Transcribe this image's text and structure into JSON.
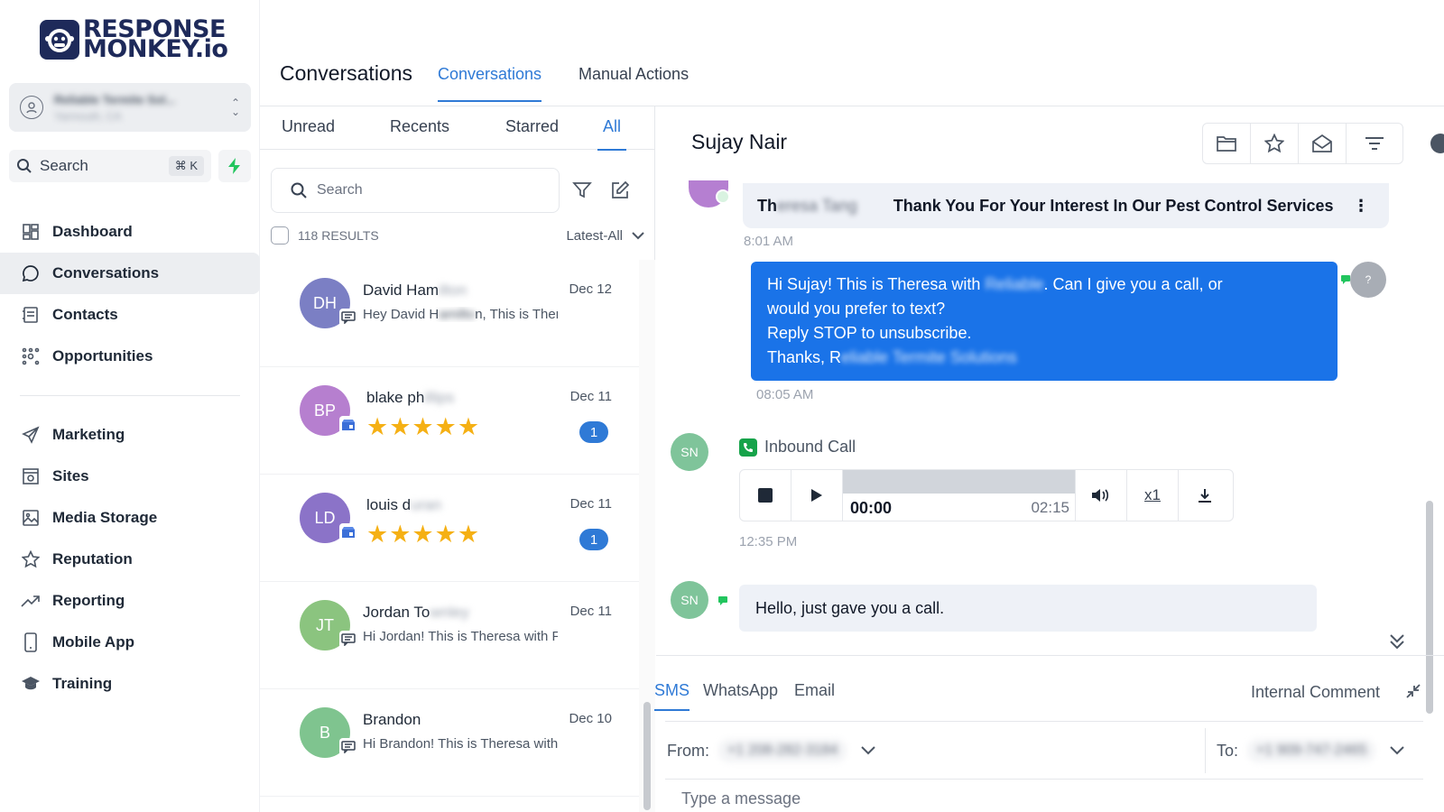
{
  "brand": {
    "line1": "RESPONSE",
    "line2": "MONKEY.io",
    "color": "#1e2a5a"
  },
  "account": {
    "name": "Reliable Termite Sol...",
    "location": "Yarmouth, CA"
  },
  "sidebar": {
    "search_label": "Search",
    "search_shortcut": "⌘ K",
    "items": [
      {
        "label": "Dashboard",
        "icon": "dashboard-icon"
      },
      {
        "label": "Conversations",
        "icon": "chat-icon"
      },
      {
        "label": "Contacts",
        "icon": "contacts-icon"
      },
      {
        "label": "Opportunities",
        "icon": "opportunities-icon"
      },
      {
        "label": "Marketing",
        "icon": "send-icon"
      },
      {
        "label": "Sites",
        "icon": "sites-icon"
      },
      {
        "label": "Media Storage",
        "icon": "image-icon"
      },
      {
        "label": "Reputation",
        "icon": "star-icon"
      },
      {
        "label": "Reporting",
        "icon": "trend-icon"
      },
      {
        "label": "Mobile App",
        "icon": "mobile-icon"
      },
      {
        "label": "Training",
        "icon": "graduation-cap-icon"
      }
    ]
  },
  "header": {
    "title": "Conversations",
    "tabs": [
      "Conversations",
      "Manual Actions"
    ]
  },
  "list": {
    "tabs": [
      "Unread",
      "Recents",
      "Starred",
      "All"
    ],
    "search_placeholder": "Search",
    "results": "118 RESULTS",
    "sort": "Latest-All",
    "conversations": [
      {
        "initials": "DH",
        "color": "#7b7fc4",
        "name": "David Ham",
        "name_hidden": "ilton",
        "date": "Dec 12",
        "preview_a": "Hey David H",
        "preview_hidden": "amilto",
        "preview_b": "n, This is Ther"
      },
      {
        "initials": "BP",
        "color": "#b67fcf",
        "name": "blake ph",
        "name_hidden": "illips",
        "date": "Dec 11",
        "stars": "★★★★★",
        "count": "1"
      },
      {
        "initials": "LD",
        "color": "#8b73c8",
        "name": "louis d",
        "name_hidden": "uran",
        "date": "Dec 11",
        "stars": "★★★★★",
        "count": "1"
      },
      {
        "initials": "JT",
        "color": "#8bc47f",
        "name": "Jordan To",
        "name_hidden": "wnley",
        "date": "Dec 11",
        "preview_a": "Hi Jordan! This is Theresa with F",
        "preview_hidden": "",
        "preview_b": ""
      },
      {
        "initials": "B",
        "color": "#7fc48f",
        "name": "Brandon",
        "name_hidden": "",
        "date": "Dec 10",
        "preview_a": "Hi Brandon! This is Theresa with",
        "preview_hidden": "",
        "preview_b": ""
      }
    ]
  },
  "chat": {
    "contact_name": "Sujay Nair",
    "email_msg": {
      "from_a": "Th",
      "from_hidden": "eresa Tang",
      "subject": "Thank You For Your Interest In Our Pest Control Services",
      "time": "8:01 AM"
    },
    "out_msg": {
      "line1_a": "Hi Sujay! This is Theresa with ",
      "line1_hidden": "Reliable",
      "line1_b": ". Can I give you a call, or",
      "line2": "would you prefer to text?",
      "line3": "Reply STOP to unsubscribe.",
      "line4_a": "Thanks, R",
      "line4_hidden": "eliable Termite Solutions",
      "time": "08:05 AM",
      "avatar": "?"
    },
    "call": {
      "avatar": "SN",
      "label": "Inbound Call",
      "current": "00:00",
      "duration": "02:15",
      "speed": "x1",
      "time": "12:35 PM",
      "progress": 0
    },
    "in_msg": {
      "avatar": "SN",
      "text": "Hello, just gave you a call."
    }
  },
  "composer": {
    "tabs": [
      "SMS",
      "WhatsApp",
      "Email"
    ],
    "internal_comment": "Internal Comment",
    "from_label": "From:",
    "from_number": "+1 208-282-3184",
    "to_label": "To:",
    "to_number": "+1 909-747-2465",
    "placeholder": "Type a message"
  },
  "colors": {
    "accent": "#2f7ad6",
    "outgoing_bubble": "#1a73e8",
    "star": "#f5b014"
  }
}
